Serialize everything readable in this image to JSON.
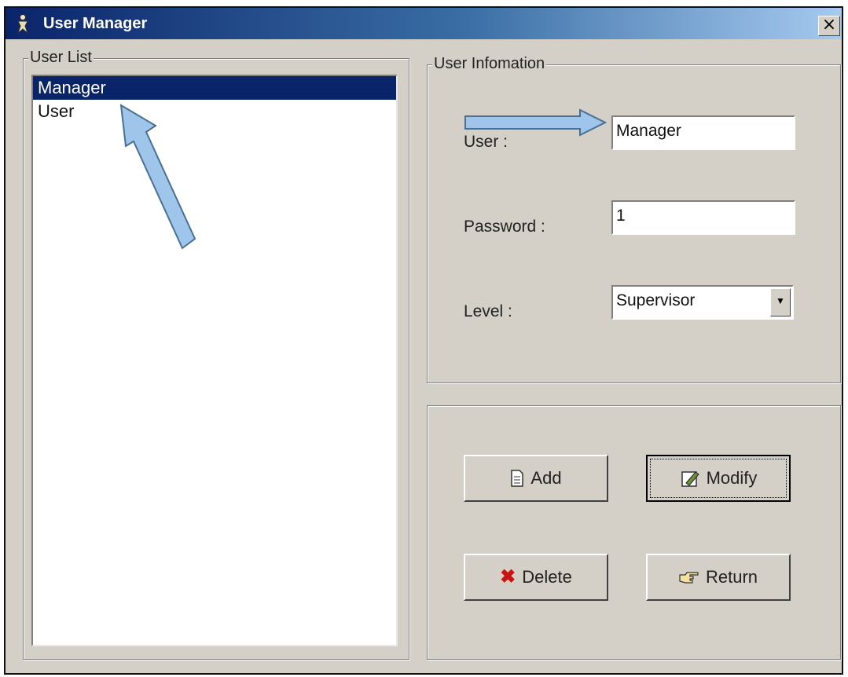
{
  "window": {
    "title": "User Manager",
    "close_glyph": "×",
    "app_icon": "app-figure-icon"
  },
  "user_list": {
    "label": "User List",
    "items": [
      {
        "label": "Manager",
        "selected": true
      },
      {
        "label": "User",
        "selected": false
      }
    ]
  },
  "user_info": {
    "label": "User Infomation",
    "user_label": "User :",
    "user_value": "Manager",
    "password_label": "Password :",
    "password_value": "1",
    "level_label": "Level :",
    "level_value": "Supervisor"
  },
  "actions": {
    "add": {
      "label": "Add",
      "icon": "document-icon"
    },
    "modify": {
      "label": "Modify",
      "icon": "edit-icon"
    },
    "delete": {
      "label": "Delete",
      "icon": "red-x-icon",
      "icon_color": "#cc1111"
    },
    "return": {
      "label": "Return",
      "icon": "pointing-hand-icon"
    }
  },
  "colors": {
    "selection": "#0a246a",
    "annotation_arrow": "#9fc6ea"
  }
}
